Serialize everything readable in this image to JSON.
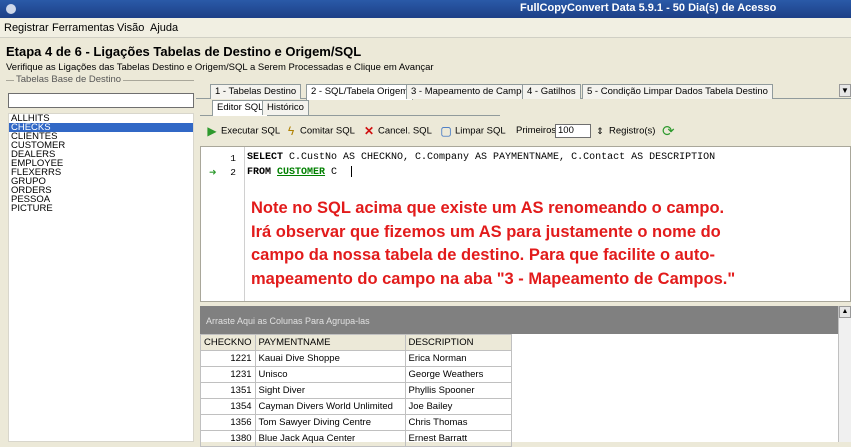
{
  "window": {
    "title": "FullCopyConvert Data 5.9.1 - 50 Dia(s) de Acesso"
  },
  "menu": [
    "Registrar",
    "Ferramentas",
    "Visão",
    "Ajuda"
  ],
  "step": {
    "title": "Etapa 4 de 6 - Ligações Tabelas de Destino e Origem/SQL",
    "subtitle": "Verifique as Ligações das Tabelas Destino e Origem/SQL a Serem Processadas e Clique em Avançar"
  },
  "left_panel": {
    "title": "Tabelas Base de Destino",
    "search_value": "",
    "items": [
      "ALLHITS",
      "CHECKS",
      "CLIENTES",
      "CUSTOMER",
      "DEALERS",
      "EMPLOYEE",
      "FLEXERRS",
      "GRUPO",
      "ORDERS",
      "PESSOA",
      "PICTURE"
    ],
    "selected": "CHECKS"
  },
  "tabs": [
    {
      "label": "1 - Tabelas Destino"
    },
    {
      "label": "2 - SQL/Tabela Origem"
    },
    {
      "label": "3 - Mapeamento de Campos"
    },
    {
      "label": "4 - Gatilhos"
    },
    {
      "label": "5 - Condição Limpar Dados Tabela Destino"
    }
  ],
  "subtabs": [
    {
      "label": "Editor SQL"
    },
    {
      "label": "Histórico"
    }
  ],
  "toolbar": {
    "execute": "Executar SQL",
    "commit": "Comitar SQL",
    "cancel": "Cancel. SQL",
    "clear": "Limpar SQL",
    "first_label": "Primeiros:",
    "first_value": "100",
    "records": "Registro(s)"
  },
  "editor": {
    "line_numbers": [
      "1",
      "2"
    ],
    "line1": {
      "kw1": "SELECT",
      "rest": " C.CustNo AS CHECKNO, C.Company AS PAYMENTNAME, C.Contact AS DESCRIPTION"
    },
    "line2": {
      "kw": "FROM",
      "table": "CUSTOMER",
      "rest": " C"
    }
  },
  "note": [
    "Note no SQL acima que existe um AS renomeando o campo.",
    "Irá observar que fizemos um AS para justamente o nome do",
    "campo da nossa tabela de destino. Para que facilite o auto-",
    "mapeamento do campo na aba \"3 - Mapeamento de Campos.\""
  ],
  "grid": {
    "group_hint": "Arraste Aqui as Colunas Para Agrupa-las",
    "columns": [
      "CHECKNO",
      "PAYMENTNAME",
      "DESCRIPTION"
    ],
    "rows": [
      [
        "1221",
        "Kauai Dive Shoppe",
        "Erica Norman"
      ],
      [
        "1231",
        "Unisco",
        "George Weathers"
      ],
      [
        "1351",
        "Sight Diver",
        "Phyllis Spooner"
      ],
      [
        "1354",
        "Cayman Divers World Unlimited",
        "Joe Bailey"
      ],
      [
        "1356",
        "Tom Sawyer Diving Centre",
        "Chris Thomas"
      ],
      [
        "1380",
        "Blue Jack Aqua Center",
        "Ernest Barratt"
      ]
    ]
  },
  "colors": {
    "note": "#e21b1b",
    "selection": "#3168c6",
    "titlebar": "#2a5aa8"
  }
}
